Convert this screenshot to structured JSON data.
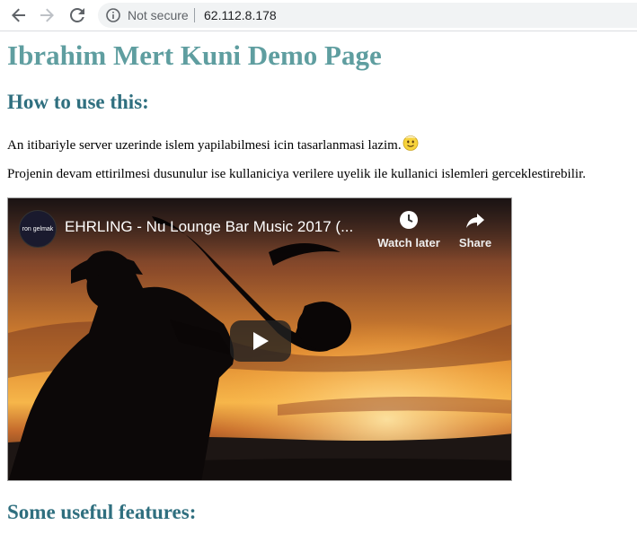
{
  "browser": {
    "security_label": "Not secure",
    "url": "62.112.8.178"
  },
  "page": {
    "title": "Ibrahim Mert Kuni Demo Page",
    "section_how": "How to use this:",
    "paragraph_1": "An itibariyle server uzerinde islem yapilabilmesi icin tasarlanmasi lazim.",
    "paragraph_2": "Projenin devam ettirilmesi dusunulur ise kullaniciya verilere uyelik ile kullanici islemleri gerceklestirebilir.",
    "section_features": "Some useful features:",
    "colors": {
      "title": "#5f9ea0",
      "heading": "#2f6f7f"
    }
  },
  "video": {
    "title": "EHRLING - Nu Lounge Bar Music 2017 (...",
    "channel_avatar_text": "ron gelmak",
    "watch_later_label": "Watch later",
    "share_label": "Share"
  },
  "icons": {
    "back": "arrow-left-icon",
    "forward": "arrow-right-icon",
    "reload": "reload-icon",
    "info": "info-icon",
    "emoji": "smiling-face-icon",
    "watch_later": "clock-icon",
    "share": "share-icon",
    "play": "play-icon"
  }
}
